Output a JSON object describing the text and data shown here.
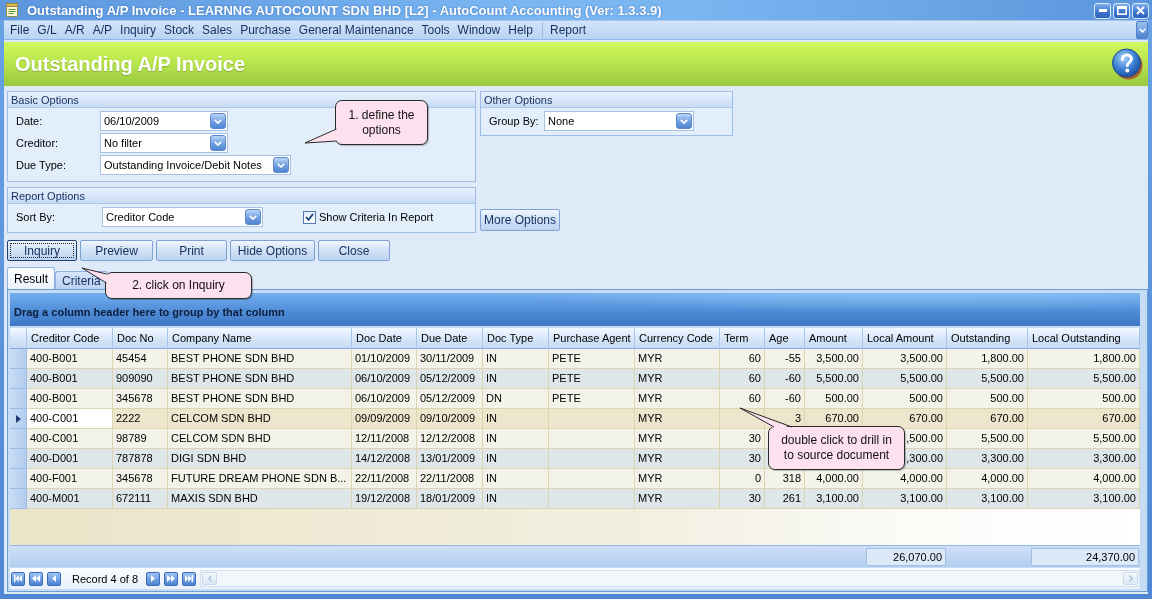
{
  "window": {
    "title": "Outstanding A/P Invoice - LEARNNG AUTOCOUNT SDN BHD [L2] - AutoCount Accounting (Ver: 1.3.3.9)"
  },
  "menu_bar": {
    "items": [
      "File",
      "G/L",
      "A/R",
      "A/P",
      "Inquiry",
      "Stock",
      "Sales",
      "Purchase",
      "General Maintenance",
      "Tools",
      "Window",
      "Help"
    ],
    "extra_items": [
      "Report"
    ]
  },
  "page_header": {
    "title": "Outstanding A/P Invoice"
  },
  "basic_options": {
    "title": "Basic Options",
    "fields": [
      {
        "label": "Date:",
        "value": "06/10/2009"
      },
      {
        "label": "Creditor:",
        "value": "No filter"
      },
      {
        "label": "Due Type:",
        "value": "Outstanding Invoice/Debit Notes"
      }
    ]
  },
  "report_options": {
    "title": "Report Options",
    "fields": [
      {
        "label": "Sort By:",
        "value": "Creditor Code"
      }
    ],
    "checkbox": {
      "label": "Show Criteria In Report",
      "checked": true
    }
  },
  "other_options": {
    "title": "Other Options",
    "fields": [
      {
        "label": "Group By:",
        "value": "None"
      }
    ]
  },
  "more_options_button": {
    "label": "More Options"
  },
  "buttons": [
    {
      "label": "Inquiry",
      "focused": true
    },
    {
      "label": "Preview",
      "focused": false
    },
    {
      "label": "Print",
      "focused": false
    },
    {
      "label": "Hide Options",
      "focused": false
    },
    {
      "label": "Close",
      "focused": false
    }
  ],
  "tabs": [
    {
      "label": "Result",
      "selected": true
    },
    {
      "label": "Criteria",
      "selected": false
    }
  ],
  "grid": {
    "group_panel_hint": "Drag a column header here to group by that column",
    "columns": [
      {
        "label": "Creditor Code",
        "kind": "text"
      },
      {
        "label": "Doc No",
        "kind": "text"
      },
      {
        "label": "Company Name",
        "kind": "text"
      },
      {
        "label": "Doc Date",
        "kind": "text"
      },
      {
        "label": "Due Date",
        "kind": "text"
      },
      {
        "label": "Doc Type",
        "kind": "text"
      },
      {
        "label": "Purchase Agent",
        "kind": "text"
      },
      {
        "label": "Currency Code",
        "kind": "text"
      },
      {
        "label": "Term",
        "kind": "number"
      },
      {
        "label": "Age",
        "kind": "number"
      },
      {
        "label": "Amount",
        "kind": "number"
      },
      {
        "label": "Local Amount",
        "kind": "number",
        "total": "26,070.00"
      },
      {
        "label": "Outstanding",
        "kind": "number"
      },
      {
        "label": "Local Outstanding",
        "kind": "number",
        "total": "24,370.00"
      }
    ],
    "rows": [
      {
        "selected": false,
        "cells": [
          "400-B001",
          "45454",
          "BEST PHONE SDN BHD",
          "01/10/2009",
          "30/11/2009",
          "IN",
          "PETE",
          "MYR",
          "60",
          "-55",
          "3,500.00",
          "3,500.00",
          "1,800.00",
          "1,800.00"
        ]
      },
      {
        "selected": false,
        "cells": [
          "400-B001",
          "909090",
          "BEST PHONE SDN BHD",
          "06/10/2009",
          "05/12/2009",
          "IN",
          "PETE",
          "MYR",
          "60",
          "-60",
          "5,500.00",
          "5,500.00",
          "5,500.00",
          "5,500.00"
        ]
      },
      {
        "selected": false,
        "cells": [
          "400-B001",
          "345678",
          "BEST PHONE SDN BHD",
          "06/10/2009",
          "05/12/2009",
          "DN",
          "PETE",
          "MYR",
          "60",
          "-60",
          "500.00",
          "500.00",
          "500.00",
          "500.00"
        ]
      },
      {
        "selected": true,
        "cells": [
          "400-C001",
          "2222",
          "CELCOM SDN BHD",
          "09/09/2009",
          "09/10/2009",
          "IN",
          null,
          "MYR",
          null,
          "3",
          "670.00",
          "670.00",
          "670.00",
          "670.00"
        ]
      },
      {
        "selected": false,
        "cells": [
          "400-C001",
          "98789",
          "CELCOM SDN BHD",
          "12/11/2008",
          "12/12/2008",
          "IN",
          null,
          "MYR",
          "30",
          null,
          null,
          ",500.00",
          "5,500.00",
          "5,500.00"
        ]
      },
      {
        "selected": false,
        "cells": [
          "400-D001",
          "787878",
          "DIGI SDN BHD",
          "14/12/2008",
          "13/01/2009",
          "IN",
          null,
          "MYR",
          "30",
          null,
          null,
          ",300.00",
          "3,300.00",
          "3,300.00"
        ]
      },
      {
        "selected": false,
        "cells": [
          "400-F001",
          "345678",
          "FUTURE DREAM PHONE SDN B...",
          "22/11/2008",
          "22/11/2008",
          "IN",
          null,
          "MYR",
          "0",
          "318",
          "4,000.00",
          "4,000.00",
          "4,000.00",
          "4,000.00"
        ]
      },
      {
        "selected": false,
        "cells": [
          "400-M001",
          "672111",
          "MAXIS SDN BHD",
          "19/12/2008",
          "18/01/2009",
          "IN",
          null,
          "MYR",
          "30",
          "261",
          "3,100.00",
          "3,100.00",
          "3,100.00",
          "3,100.00"
        ]
      }
    ]
  },
  "navigator": {
    "record_text": "Record 4 of 8"
  },
  "callouts": [
    {
      "text": "1. define the options"
    },
    {
      "text": "2. click on Inquiry"
    },
    {
      "text": "double click to drill in to source document"
    }
  ]
}
